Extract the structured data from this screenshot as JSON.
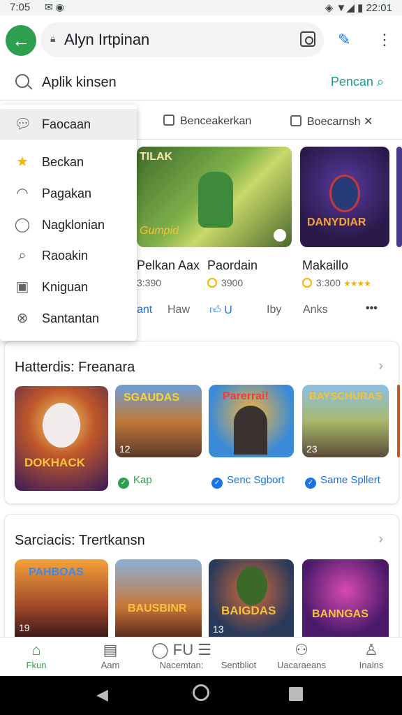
{
  "status_bar": {
    "time": "7:05",
    "right_text": "22:01"
  },
  "url_bar": {
    "url": "Alyn Irtpinan"
  },
  "search": {
    "query": "Aplik kinsen",
    "action_label": "Pencan"
  },
  "filters": [
    {
      "label": "Benceakerkan"
    },
    {
      "label": "Boecarnsh"
    }
  ],
  "menu": {
    "items": [
      {
        "label": "Faocaan",
        "icon": "chat-bubble-icon",
        "selected": true
      },
      {
        "label": "Beckan",
        "icon": "star-icon",
        "selected": false
      },
      {
        "label": "Pagakan",
        "icon": "bell-icon",
        "selected": false
      },
      {
        "label": "Nagklonian",
        "icon": "pin-icon",
        "selected": false
      },
      {
        "label": "Raoakin",
        "icon": "search-bubble-icon",
        "selected": false
      },
      {
        "label": "Kniguan",
        "icon": "calendar-icon",
        "selected": false
      },
      {
        "label": "Santantan",
        "icon": "compass-icon",
        "selected": false
      }
    ]
  },
  "featured": {
    "games": [
      {
        "title": "Pelkan Aax",
        "price": "3:390",
        "tile_text": "Gumpid"
      },
      {
        "title": "Paordain",
        "price": "3900",
        "tile_text": "DANYDIAR"
      },
      {
        "title": "Makaillo",
        "price": "3:300",
        "rating_stars": "★★★★"
      }
    ],
    "actions": [
      "ant",
      "Haw",
      "U",
      "Iby",
      "Anks",
      "•••"
    ]
  },
  "section1": {
    "title": "Hatterdis: Freanara",
    "tiles": [
      {
        "label": "DOKHACK",
        "num": ""
      },
      {
        "label": "SGAUDAS",
        "num": "12"
      },
      {
        "label": "Parerrai!",
        "num": ""
      },
      {
        "label": "BAYSCHURAS",
        "num": "23"
      }
    ],
    "badges": [
      {
        "label": "Kap",
        "color": "#2e9e4f"
      },
      {
        "label": "Senc Sgbort",
        "color": "#1a73e8"
      },
      {
        "label": "Same Spllert",
        "color": "#1a73e8"
      }
    ]
  },
  "section2": {
    "title": "Sarciacis: Trertkansn",
    "tiles": [
      {
        "label": "PAHBOAS",
        "num": "19"
      },
      {
        "label": "BAUSBINR",
        "num": ""
      },
      {
        "label": "BAIGDAS",
        "num": "13"
      },
      {
        "label": "BANNGAS",
        "num": ""
      }
    ]
  },
  "bottom_nav": [
    {
      "label": "Fkun",
      "icon": "home-icon",
      "active": true
    },
    {
      "label": "Aam",
      "icon": "news-icon",
      "active": false
    },
    {
      "label": "Nacemtan:",
      "icon": "chat-icon",
      "active": false
    },
    {
      "label": "Sentbliot",
      "icon": "list-icon",
      "active": false
    },
    {
      "label": "Uacaraeans",
      "icon": "people-icon",
      "active": false
    },
    {
      "label": "Inains",
      "icon": "person-icon",
      "active": false
    }
  ],
  "colors": {
    "accent": "#2e9e4f",
    "link": "#1a9c8e",
    "blue": "#1a73e8"
  }
}
